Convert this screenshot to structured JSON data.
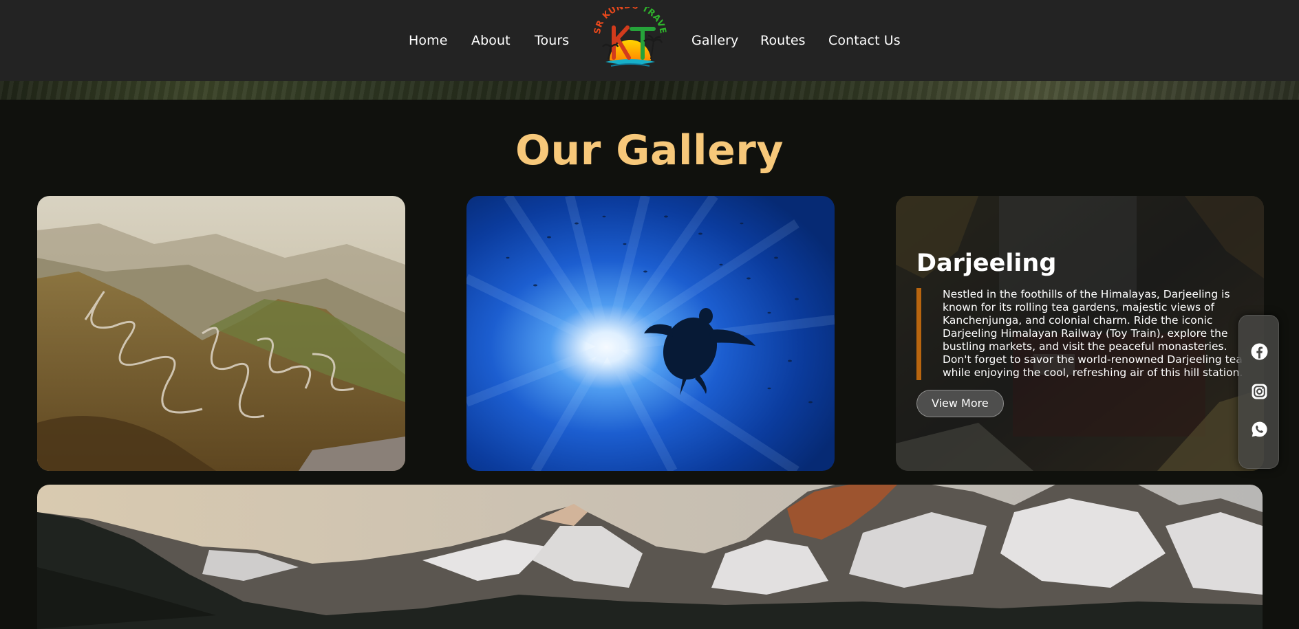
{
  "nav": {
    "links_left": [
      "Home",
      "About",
      "Tours"
    ],
    "links_right": [
      "Gallery",
      "Routes",
      "Contact Us"
    ],
    "logo": {
      "text_top": "SR KUNDU TRAVEL",
      "monogram": "KT",
      "icon": "palm-sunset-logo"
    }
  },
  "gallery": {
    "title": "Our Gallery",
    "cards": [
      {
        "image": "winding-mountain-road"
      },
      {
        "image": "sea-turtle-underwater"
      },
      {
        "image": "darjeeling-toy-train",
        "title": "Darjeeling",
        "description": "Nestled in the foothills of the Himalayas, Darjeeling is known for its rolling tea gardens, majestic views of Kanchenjunga, and colonial charm. Ride the iconic Darjeeling Himalayan Railway (Toy Train), explore the bustling markets, and visit the peaceful monasteries. Don't forget to savor the world-renowned Darjeeling tea while enjoying the cool, refreshing air of this hill station.",
        "button": "View More"
      }
    ],
    "wide_card": {
      "image": "snowy-mountain-range"
    }
  },
  "social": [
    "facebook-icon",
    "instagram-icon",
    "whatsapp-icon"
  ],
  "colors": {
    "background": "#10110d",
    "navbar": "#232323",
    "title": "#f7c87a",
    "accent_bar": "#b8650f"
  }
}
